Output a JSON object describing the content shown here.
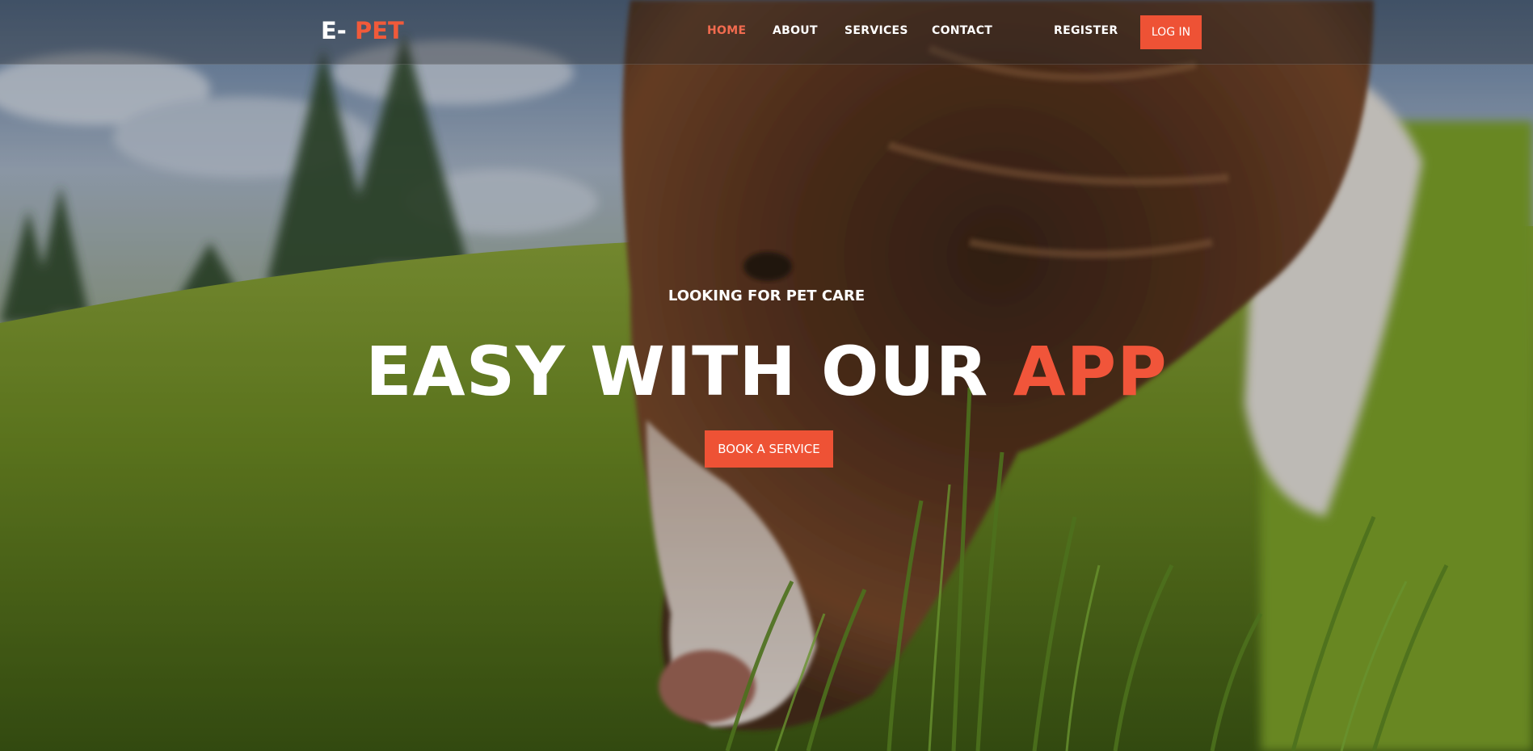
{
  "brand": {
    "logo_prefix": "E-",
    "logo_accent": "PET",
    "accent_color": "#ee5235"
  },
  "nav": {
    "items": [
      {
        "label": "HOME",
        "active": true
      },
      {
        "label": "ABOUT",
        "active": false
      },
      {
        "label": "SERVICES",
        "active": false
      },
      {
        "label": "CONTACT",
        "active": false
      },
      {
        "label": "REGISTER",
        "active": false
      }
    ],
    "login_label": "LOG IN"
  },
  "hero": {
    "kicker": "LOOKING FOR PET CARE",
    "headline_main": "EASY WITH OUR",
    "headline_accent": "APP",
    "cta_label": "BOOK A SERVICE"
  }
}
